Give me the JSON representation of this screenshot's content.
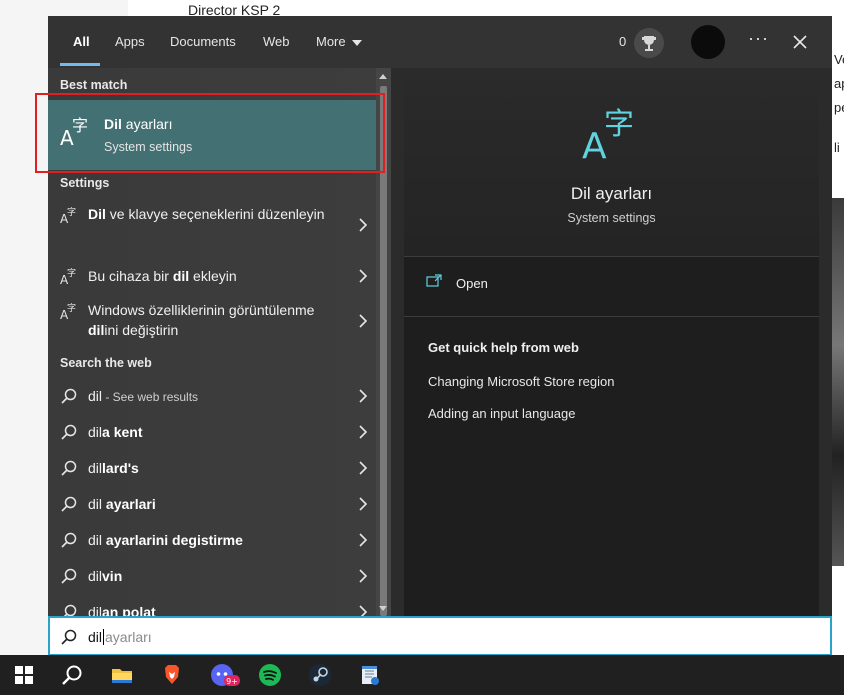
{
  "background": {
    "top_text": "Director KSP 2",
    "right_fragments": [
      "Ve",
      "ap",
      "pe",
      "li"
    ]
  },
  "tabs": [
    {
      "label": "All",
      "active": true
    },
    {
      "label": "Apps"
    },
    {
      "label": "Documents"
    },
    {
      "label": "Web"
    },
    {
      "label": "More"
    }
  ],
  "header": {
    "points": "0",
    "more_options": "···"
  },
  "best_match": {
    "section": "Best match",
    "title_bold": "Dil",
    "title_rest": " ayarları",
    "subtitle": "System settings"
  },
  "settings": {
    "section": "Settings",
    "items": [
      {
        "parts": [
          {
            "t": "Dil",
            "b": true
          },
          {
            "t": " ve klavye seçeneklerini düzenleyin"
          }
        ]
      },
      {
        "parts": [
          {
            "t": "Bu cihaza bir "
          },
          {
            "t": "dil",
            "b": true
          },
          {
            "t": " ekleyin"
          }
        ]
      },
      {
        "parts": [
          {
            "t": "Windows özelliklerinin görüntülenme "
          },
          {
            "t": "dil",
            "b": true
          },
          {
            "t": "ini değiştirin"
          }
        ]
      }
    ]
  },
  "web": {
    "section": "Search the web",
    "items": [
      {
        "parts": [
          {
            "t": "dil"
          },
          {
            "t": " - See web results",
            "m": true
          }
        ]
      },
      {
        "parts": [
          {
            "t": "dil"
          },
          {
            "t": "a kent",
            "b": true
          }
        ]
      },
      {
        "parts": [
          {
            "t": "dil"
          },
          {
            "t": "lard's",
            "b": true
          }
        ]
      },
      {
        "parts": [
          {
            "t": "dil "
          },
          {
            "t": "ayarlari",
            "b": true
          }
        ]
      },
      {
        "parts": [
          {
            "t": "dil "
          },
          {
            "t": "ayarlarini degistirme",
            "b": true
          }
        ]
      },
      {
        "parts": [
          {
            "t": "dil"
          },
          {
            "t": "vin",
            "b": true
          }
        ]
      },
      {
        "parts": [
          {
            "t": "dil"
          },
          {
            "t": "an polat",
            "b": true
          }
        ]
      }
    ]
  },
  "preview": {
    "title": "Dil ayarları",
    "subtitle": "System settings",
    "open_label": "Open",
    "help_title": "Get quick help from web",
    "help_links": [
      "Changing Microsoft Store region",
      "Adding an input language"
    ]
  },
  "search": {
    "typed": "dil",
    "suggestion": "ayarları"
  },
  "taskbar": {
    "badge": "9+",
    "items": [
      "windows-start",
      "search",
      "file-explorer",
      "brave",
      "discord",
      "spotify",
      "steam",
      "notepad"
    ]
  },
  "colors": {
    "accent": "#76b9ed",
    "best_match_bg": "#437073",
    "icon_cyan": "#5fd3e0",
    "highlight_border": "#e02020",
    "searchbox_border": "#2aa3c8"
  }
}
